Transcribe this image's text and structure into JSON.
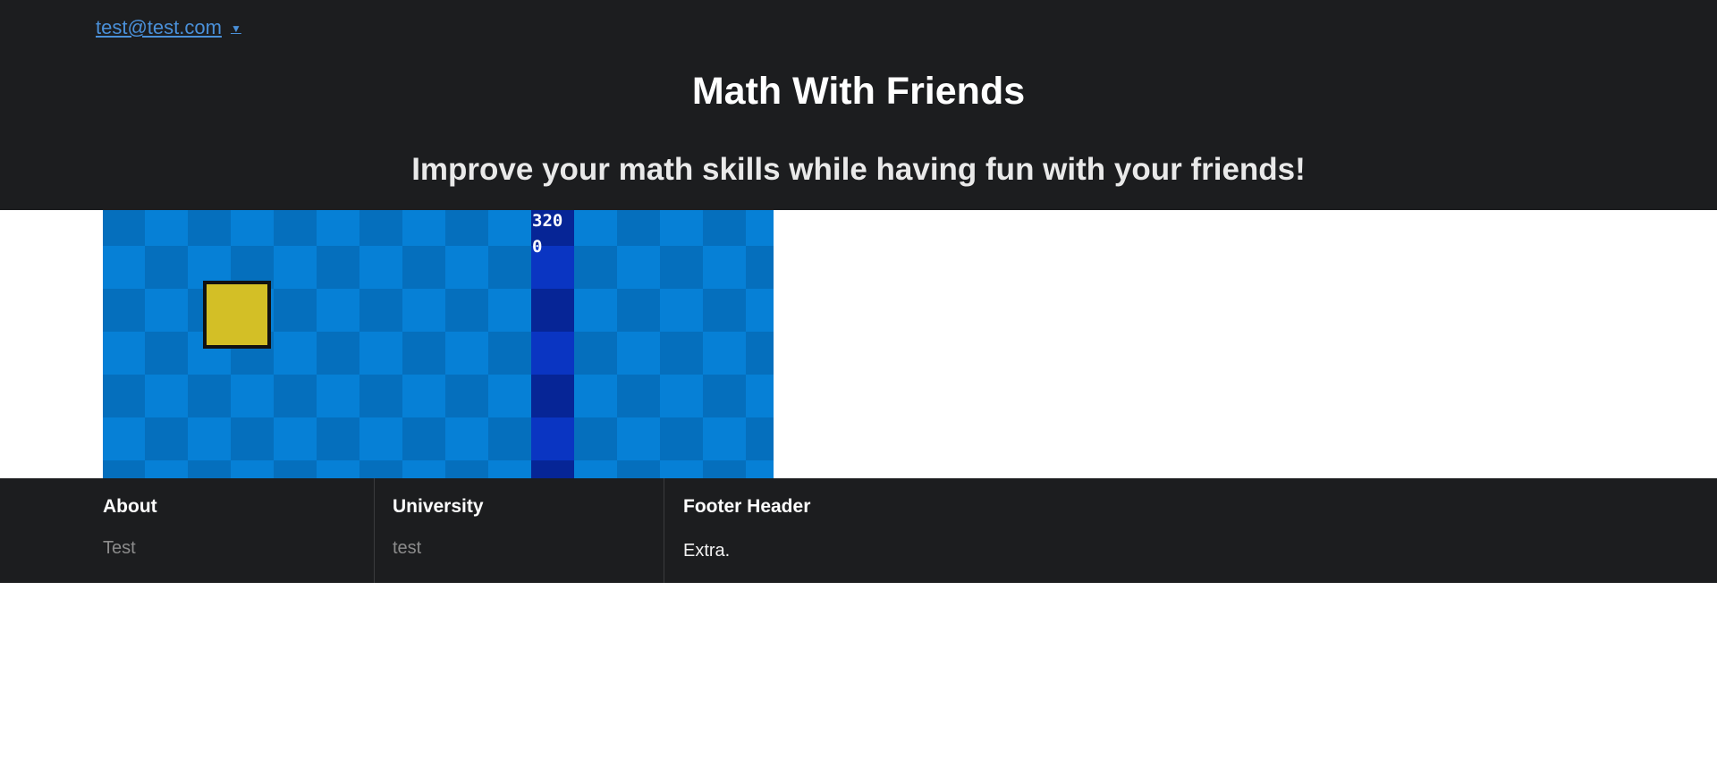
{
  "header": {
    "user_email": "test@test.com",
    "title": "Math With Friends",
    "tagline": "Improve your math skills while having fun with your friends!"
  },
  "game": {
    "score_top": "320",
    "score_bottom": "0",
    "colors": {
      "tile_light": "#0680d6",
      "tile_dark": "#056fbd",
      "lane_light": "#0a35c2",
      "lane_dark": "#062596",
      "player_fill": "#d3bf26",
      "player_border": "#111111"
    }
  },
  "footer": {
    "about": {
      "heading": "About",
      "link": "Test"
    },
    "university": {
      "heading": "University",
      "link": "test"
    },
    "extra": {
      "heading": "Footer Header",
      "text": "Extra."
    }
  }
}
